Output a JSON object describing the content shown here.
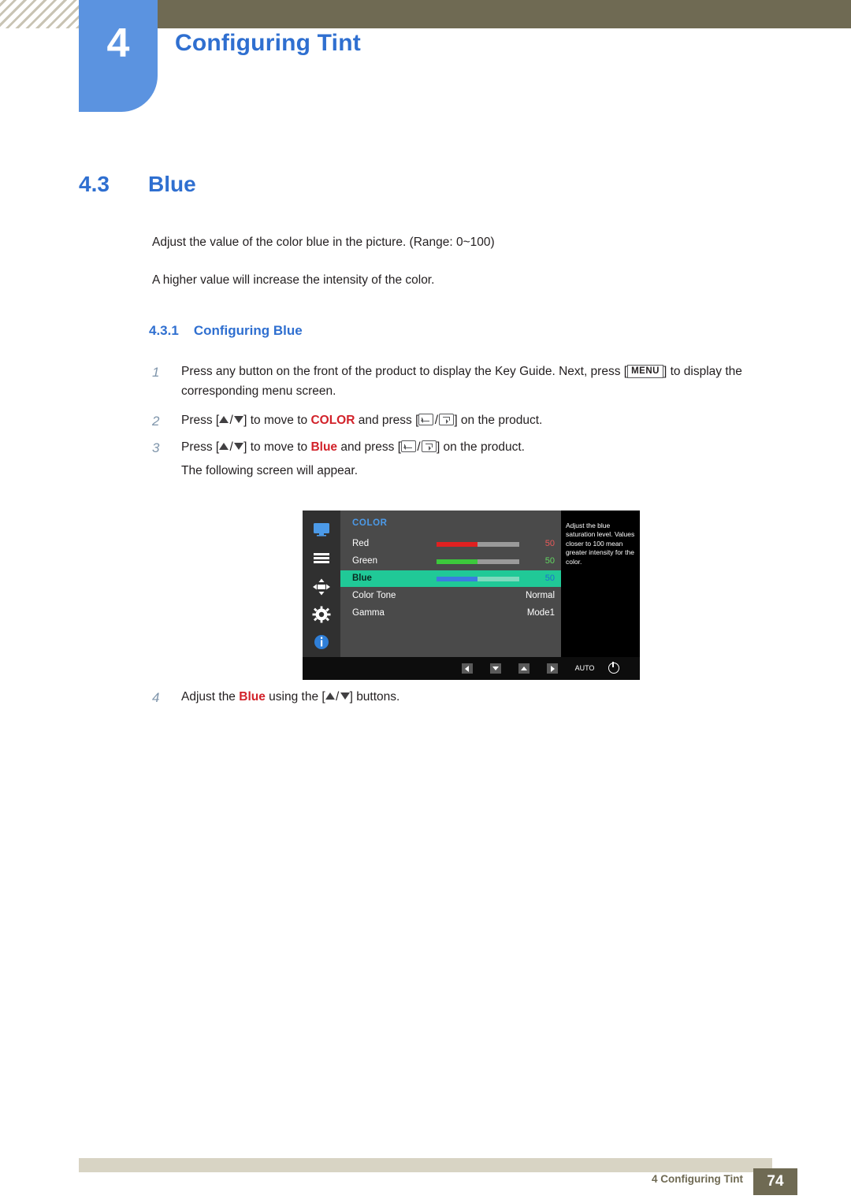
{
  "header": {
    "chapter_number": "4",
    "chapter_title": "Configuring Tint"
  },
  "section": {
    "number": "4.3",
    "title": "Blue",
    "paragraph_1": "Adjust the value of the color blue in the picture. (Range: 0~100)",
    "paragraph_2": "A higher value will increase the intensity of the color."
  },
  "subsection": {
    "number": "4.3.1",
    "title": "Configuring Blue"
  },
  "steps": [
    {
      "number": "1",
      "text_a": "Press any button on the front of the product to display the Key Guide. Next, press [",
      "key": "MENU",
      "text_b": "] to display the corresponding menu screen."
    },
    {
      "number": "2",
      "text_a": "Press [",
      "text_b": "] to move to ",
      "keyword": "COLOR",
      "text_c": " and press [",
      "text_d": "] on the product."
    },
    {
      "number": "3",
      "text_a": "Press [",
      "text_b": "] to move to ",
      "keyword": "Blue",
      "text_c": " and press [",
      "text_d": "] on the product."
    },
    {
      "number": "4",
      "text_a": "Adjust the ",
      "keyword": "Blue",
      "text_b": " using the [",
      "text_c": "] buttons."
    }
  ],
  "following_text": "The following screen will appear.",
  "osd": {
    "menu_title": "COLOR",
    "rows": [
      {
        "label": "Red",
        "value": "50",
        "type": "slider",
        "fill_color": "#e02020",
        "value_color": "#e85a5a",
        "selected": false
      },
      {
        "label": "Green",
        "value": "50",
        "type": "slider",
        "fill_color": "#3cc83c",
        "value_color": "#62d862",
        "selected": false
      },
      {
        "label": "Blue",
        "value": "50",
        "type": "slider",
        "fill_color": "#3c7ce0",
        "value_color": "#1b6fd0",
        "selected": true
      },
      {
        "label": "Color Tone",
        "value": "Normal",
        "type": "text",
        "selected": false
      },
      {
        "label": "Gamma",
        "value": "Mode1",
        "type": "text",
        "selected": false
      }
    ],
    "help_text": "Adjust the blue saturation level. Values closer to 100 mean greater intensity for the color.",
    "footer_buttons": [
      "left",
      "down",
      "up",
      "right",
      "AUTO",
      "power"
    ],
    "auto_label": "AUTO"
  },
  "footer": {
    "text": "4 Configuring Tint",
    "page": "74"
  },
  "colors": {
    "accent_blue": "#2f6fd0",
    "badge_blue": "#5b93e0",
    "olive": "#6f6a53",
    "olive_light": "#d8d4c4",
    "highlight_green": "#20c997",
    "red": "#d2222a"
  }
}
